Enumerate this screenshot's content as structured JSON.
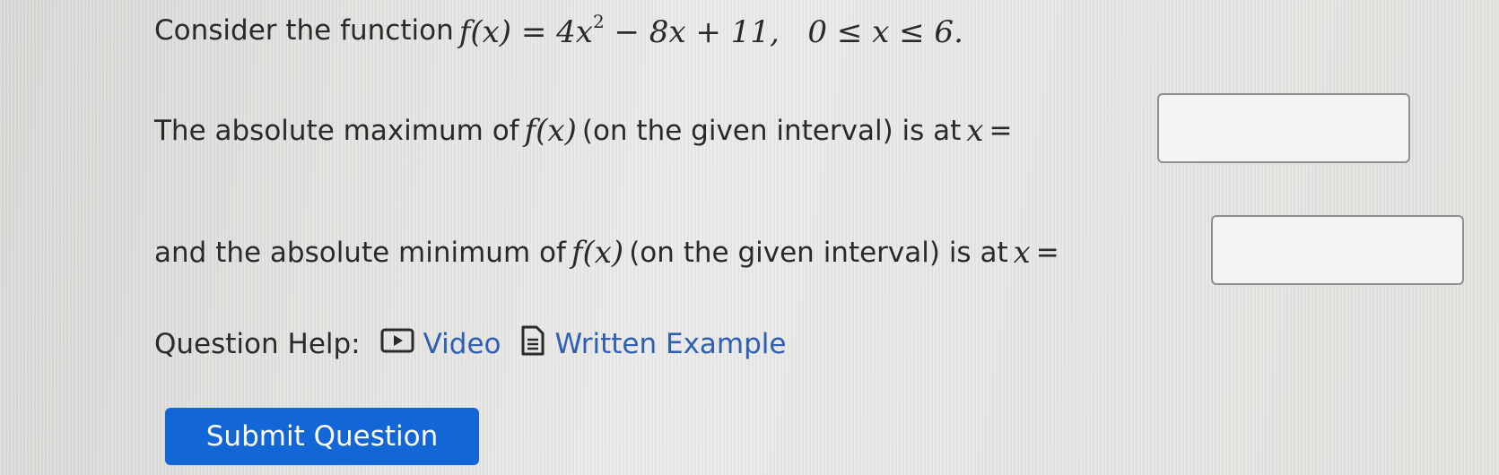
{
  "question": {
    "intro_text": "Consider the function",
    "function_lhs": "f(x)",
    "function_eq": "=",
    "function_rhs_a": "4x",
    "function_rhs_exp": "2",
    "function_rhs_b": "− 8x + 11,",
    "domain": "0 ≤ x ≤ 6."
  },
  "max_prompt": {
    "text_before": "The absolute maximum of",
    "func": "f(x)",
    "text_after": "(on the given interval) is at",
    "var": "x",
    "equals": "=",
    "answer_value": ""
  },
  "min_prompt": {
    "text_before": "and the absolute minimum of",
    "func": "f(x)",
    "text_after": "(on the given interval) is at",
    "var": "x",
    "equals": "=",
    "answer_value": ""
  },
  "help": {
    "label": "Question Help:",
    "video_label": "Video",
    "written_label": "Written Example",
    "link_color": "#2f5fb3"
  },
  "submit": {
    "label": "Submit Question",
    "color": "#1366d6"
  }
}
